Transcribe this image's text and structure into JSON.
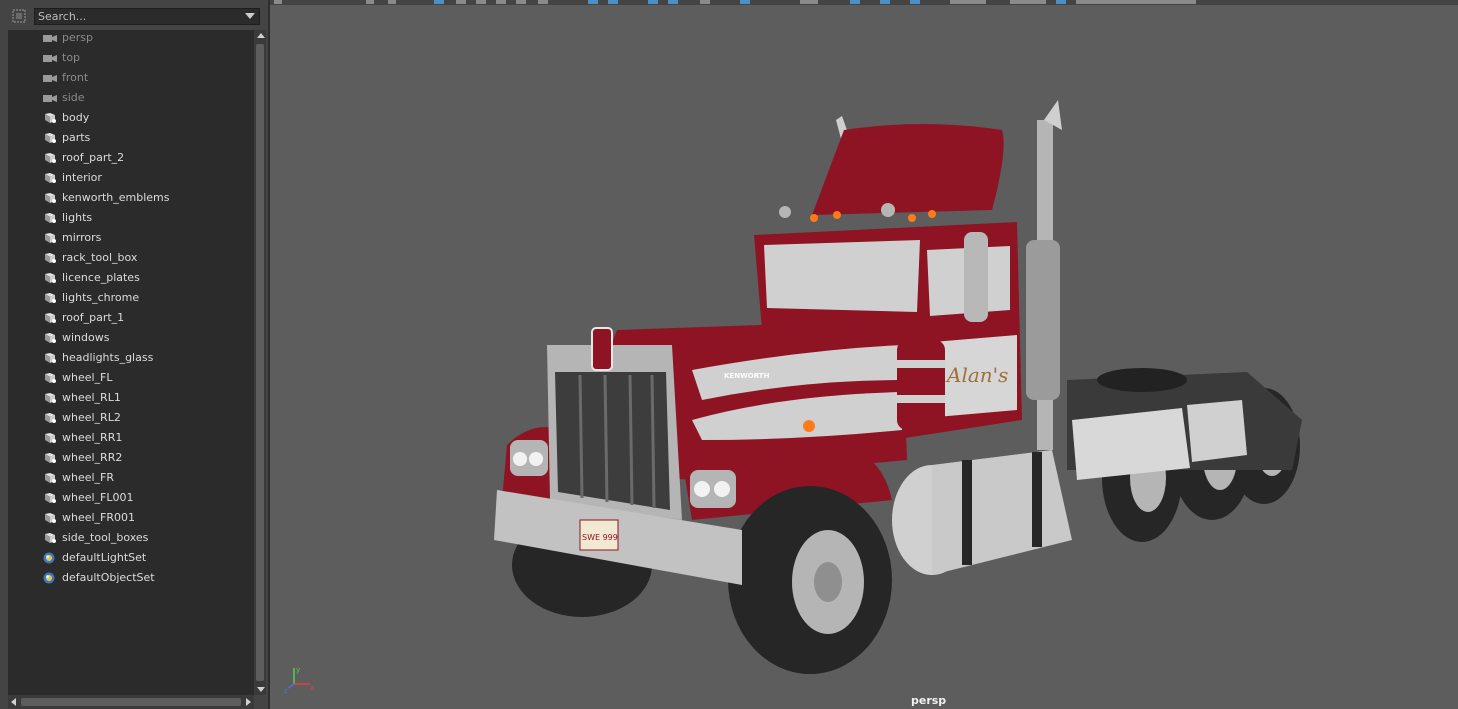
{
  "outliner": {
    "search_placeholder": "Search...",
    "items": [
      {
        "label": "persp",
        "type": "camera",
        "dim": true
      },
      {
        "label": "top",
        "type": "camera",
        "dim": true
      },
      {
        "label": "front",
        "type": "camera",
        "dim": true
      },
      {
        "label": "side",
        "type": "camera",
        "dim": true
      },
      {
        "label": "body",
        "type": "group",
        "dim": false
      },
      {
        "label": "parts",
        "type": "group",
        "dim": false
      },
      {
        "label": "roof_part_2",
        "type": "group",
        "dim": false
      },
      {
        "label": "interior",
        "type": "group",
        "dim": false
      },
      {
        "label": "kenworth_emblems",
        "type": "group",
        "dim": false
      },
      {
        "label": "lights",
        "type": "group",
        "dim": false
      },
      {
        "label": "mirrors",
        "type": "group",
        "dim": false
      },
      {
        "label": "rack_tool_box",
        "type": "group",
        "dim": false
      },
      {
        "label": "licence_plates",
        "type": "group",
        "dim": false
      },
      {
        "label": "lights_chrome",
        "type": "group",
        "dim": false
      },
      {
        "label": "roof_part_1",
        "type": "group",
        "dim": false
      },
      {
        "label": "windows",
        "type": "group",
        "dim": false
      },
      {
        "label": "headlights_glass",
        "type": "group",
        "dim": false
      },
      {
        "label": "wheel_FL",
        "type": "group",
        "dim": false
      },
      {
        "label": "wheel_RL1",
        "type": "group",
        "dim": false
      },
      {
        "label": "wheel_RL2",
        "type": "group",
        "dim": false
      },
      {
        "label": "wheel_RR1",
        "type": "group",
        "dim": false
      },
      {
        "label": "wheel_RR2",
        "type": "group",
        "dim": false
      },
      {
        "label": "wheel_FR",
        "type": "group",
        "dim": false
      },
      {
        "label": "wheel_FL001",
        "type": "group",
        "dim": false
      },
      {
        "label": "wheel_FR001",
        "type": "group",
        "dim": false
      },
      {
        "label": "side_tool_boxes",
        "type": "group",
        "dim": false
      },
      {
        "label": "defaultLightSet",
        "type": "set",
        "dim": false
      },
      {
        "label": "defaultObjectSet",
        "type": "set",
        "dim": false
      }
    ]
  },
  "viewport": {
    "camera_name": "persp",
    "background_color": "#5d5d5d"
  },
  "truck": {
    "logo_text": "KENWORTH",
    "side_script": "Alan's",
    "plate_text": "SWE 999",
    "colors": {
      "paint_red": "#8e1424",
      "paint_white": "#c9c9c9",
      "chrome": "#b5b5b5",
      "tire": "#262626",
      "amber": "#ff7a1a"
    }
  },
  "axis": {
    "x_label": "x",
    "y_label": "y",
    "z_label": "z"
  }
}
